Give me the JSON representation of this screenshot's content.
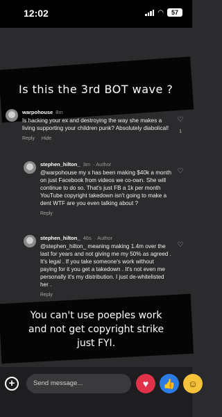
{
  "status": {
    "time": "12:02",
    "battery": "57"
  },
  "banners": {
    "top": "Is this the 3rd BOT wave ?",
    "bottom_line1": "You can't use poeples work",
    "bottom_line2": "and not get copyright strike",
    "bottom_line3": "just FYI."
  },
  "comments": [
    {
      "username": "warpohouse",
      "time": "8m",
      "text": "Is hacking your ex and destroying the way she makes a living supporting your children punk? Absolutely diabolical!",
      "reply_label": "Reply",
      "hide_label": "Hide",
      "likes": "1"
    },
    {
      "username": "stephen_hilton_",
      "time": "3m",
      "role": "Author",
      "text": "@warpohouse my x has been making $40k a month on just Facebook from videos we co-own. She will continue to do so. That's just FB a 1k per month YouTube copyright takedown isn't going to make a dent WTF are you even talking about ?",
      "reply_label": "Reply"
    },
    {
      "username": "stephen_hilton_",
      "time": "46s",
      "role": "Author",
      "text": "@stephen_hilton_ meaning making 1.4m over the last for years and not giving me my 50% as agreed . It's legal . If you take someone's work without paying for it you get a takedown . It's not even me personally it's my distribution. I just de-whitelisted her .",
      "reply_label": "Reply"
    }
  ],
  "composer": {
    "placeholder": "Send message..."
  },
  "icons": {
    "add": "plus-circle-icon",
    "heart_react": "heart-icon",
    "like_react": "thumbs-up-icon",
    "emoji_react": "emoji-icon"
  }
}
